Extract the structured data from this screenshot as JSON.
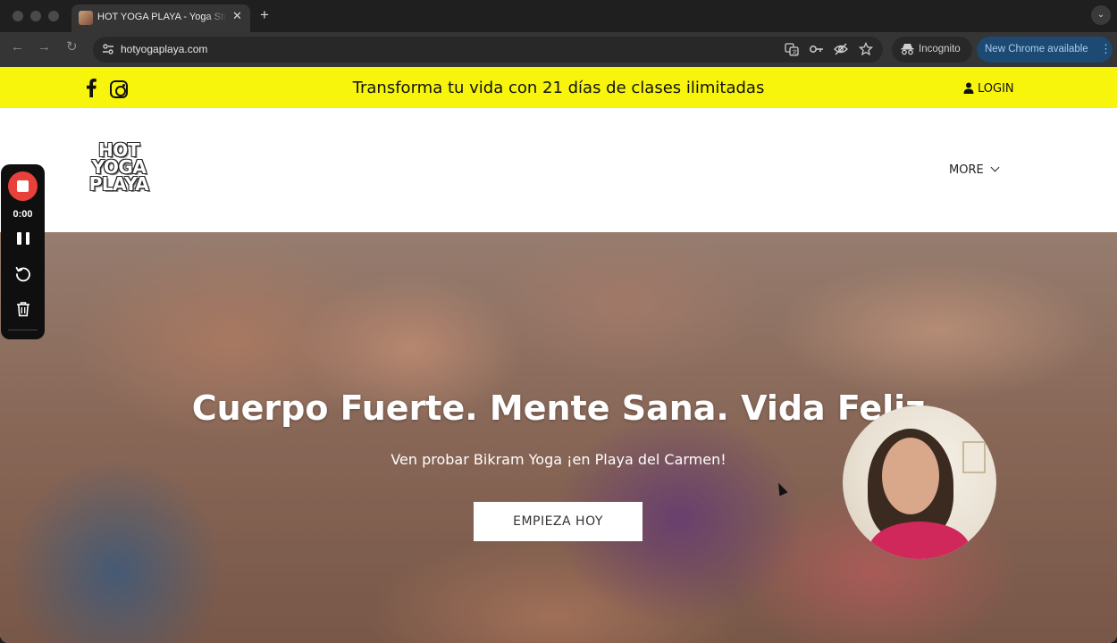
{
  "browser": {
    "tab": {
      "title": "HOT YOGA PLAYA - Yoga Studio",
      "close_glyph": "✕"
    },
    "new_tab_glyph": "+",
    "tab_list_glyph": "⌄",
    "nav": {
      "back": "←",
      "forward": "→",
      "reload": "↻"
    },
    "url": "hotyogaplaya.com",
    "incognito_label": "Incognito",
    "update_label": "New Chrome available",
    "menu_glyph": "⋮",
    "omnibox_icons": [
      "translate-icon",
      "password-key-icon",
      "eye-off-icon",
      "star-icon"
    ]
  },
  "site": {
    "promo_text": "Transforma tu vida con 21 días de clases ilimitadas",
    "login_label": "LOGIN",
    "logo_lines": [
      "HOT",
      "YOGA",
      "PLAYA"
    ],
    "menu_label": "MORE",
    "hero": {
      "title": "Cuerpo Fuerte. Mente Sana. Vida Feliz",
      "subtitle": "Ven probar Bikram Yoga ¡en Playa del Carmen!",
      "cta_label": "EMPIEZA HOY"
    },
    "colors": {
      "promo_bar": "#f8f50c",
      "cta_bg": "#ffffff",
      "hero_text": "#ffffff"
    }
  },
  "recorder": {
    "time": "0:00",
    "stop_color": "#e8413c"
  }
}
